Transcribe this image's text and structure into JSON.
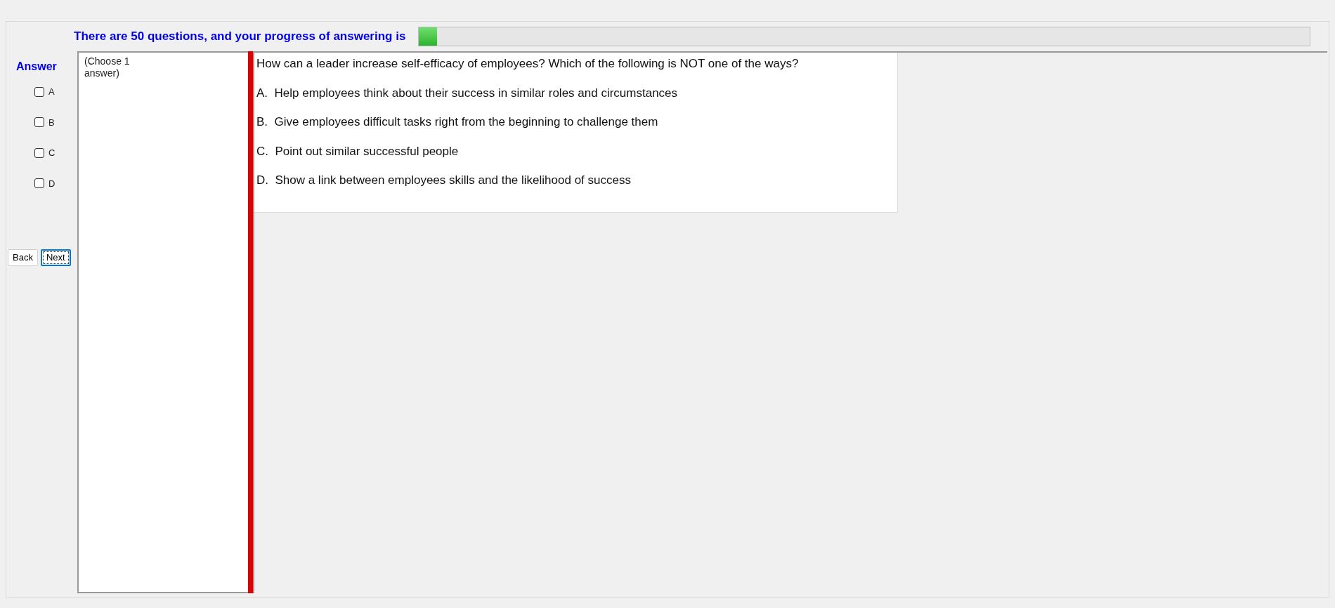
{
  "progress": {
    "label": "There are 50 questions, and your progress of answering is",
    "level": 0.02
  },
  "answer": {
    "title": "Answer",
    "options": [
      {
        "label": "A",
        "checked": false
      },
      {
        "label": "B",
        "checked": false
      },
      {
        "label": "C",
        "checked": false
      },
      {
        "label": "D",
        "checked": false
      }
    ]
  },
  "buttons": [
    {
      "label": "Back",
      "focused": false
    },
    {
      "label": "Next",
      "focused": true
    }
  ],
  "instruction": "(Choose 1 answer)",
  "question": {
    "text": "How can a leader increase self-efficacy of employees? Which of the following is NOT one of the ways?",
    "choices": [
      "A.  Help employees think about their success in similar roles and circumstances",
      "B.  Give employees difficult tasks right from the beginning to challenge them",
      "C.  Point out similar successful people",
      "D.  Show a link between employees skills and the likelihood of success"
    ]
  }
}
